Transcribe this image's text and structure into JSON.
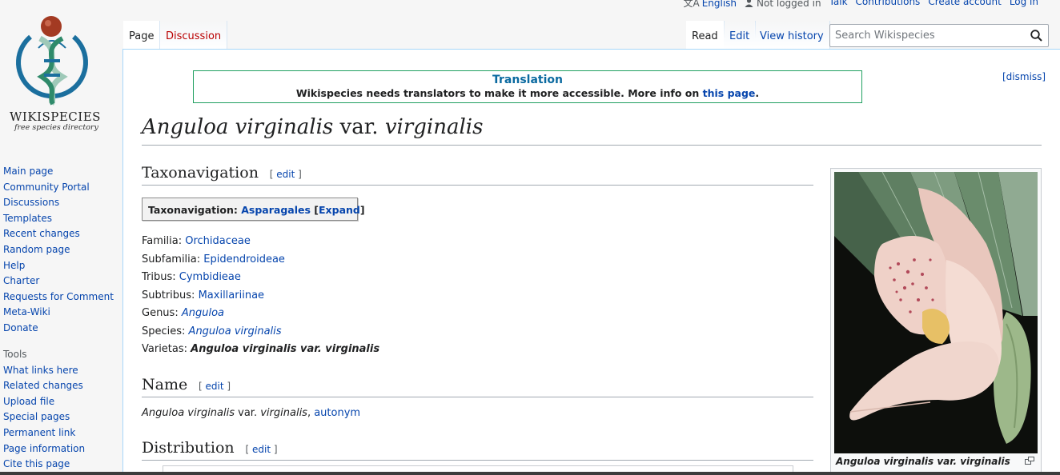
{
  "personal": {
    "language": "English",
    "not_logged_in": "Not logged in",
    "talk": "Talk",
    "contributions": "Contributions",
    "create_account": "Create account",
    "log_in": "Log in"
  },
  "logo": {
    "wordmark": "WIKISPECIES",
    "tagline": "free species directory"
  },
  "sidebar": {
    "navigation": [
      "Main page",
      "Community Portal",
      "Discussions",
      "Templates",
      "Recent changes",
      "Random page",
      "Help",
      "Charter",
      "Requests for Comment",
      "Meta-Wiki",
      "Donate"
    ],
    "tools_heading": "Tools",
    "tools": [
      "What links here",
      "Related changes",
      "Upload file",
      "Special pages",
      "Permanent link",
      "Page information",
      "Cite this page"
    ]
  },
  "tabs": {
    "page": "Page",
    "discussion": "Discussion",
    "read": "Read",
    "edit": "Edit",
    "history": "View history"
  },
  "search": {
    "placeholder": "Search Wikispecies"
  },
  "notice": {
    "title": "Translation",
    "body": "Wikispecies needs translators to make it more accessible. More info on ",
    "link": "this page",
    "end": ".",
    "dismiss": "[dismiss]"
  },
  "page": {
    "title_part1": "Anguloa virginalis",
    "title_part2": " var. ",
    "title_part3": "virginalis",
    "edit_label": "edit",
    "sections": {
      "taxonavigation": "Taxonavigation",
      "name": "Name",
      "distribution": "Distribution"
    },
    "taxobox": {
      "label": "Taxonavigation: ",
      "link": "Asparagales",
      "expand": "Expand"
    },
    "ranks": [
      {
        "rank": "Familia: ",
        "value": "Orchidaceae"
      },
      {
        "rank": "Subfamilia: ",
        "value": "Epidendroideae"
      },
      {
        "rank": "Tribus: ",
        "value": "Cymbidieae"
      },
      {
        "rank": "Subtribus: ",
        "value": "Maxillariinae"
      },
      {
        "rank": "Genus: ",
        "value": "Anguloa"
      },
      {
        "rank": "Species: ",
        "value": "Anguloa virginalis"
      },
      {
        "rank": "Varietas: ",
        "value": "Anguloa virginalis var. virginalis"
      }
    ],
    "name_line": {
      "italic1": "Anguloa virginalis",
      "mid": " var. ",
      "italic2": "virginalis",
      "sep": ", ",
      "link": "autonym"
    },
    "image_caption": "Anguloa virginalis var. virginalis"
  },
  "colors": {
    "link": "#0645ad",
    "new_link": "#ba0000",
    "border": "#a7d7f9",
    "notice_border": "#20a060"
  }
}
